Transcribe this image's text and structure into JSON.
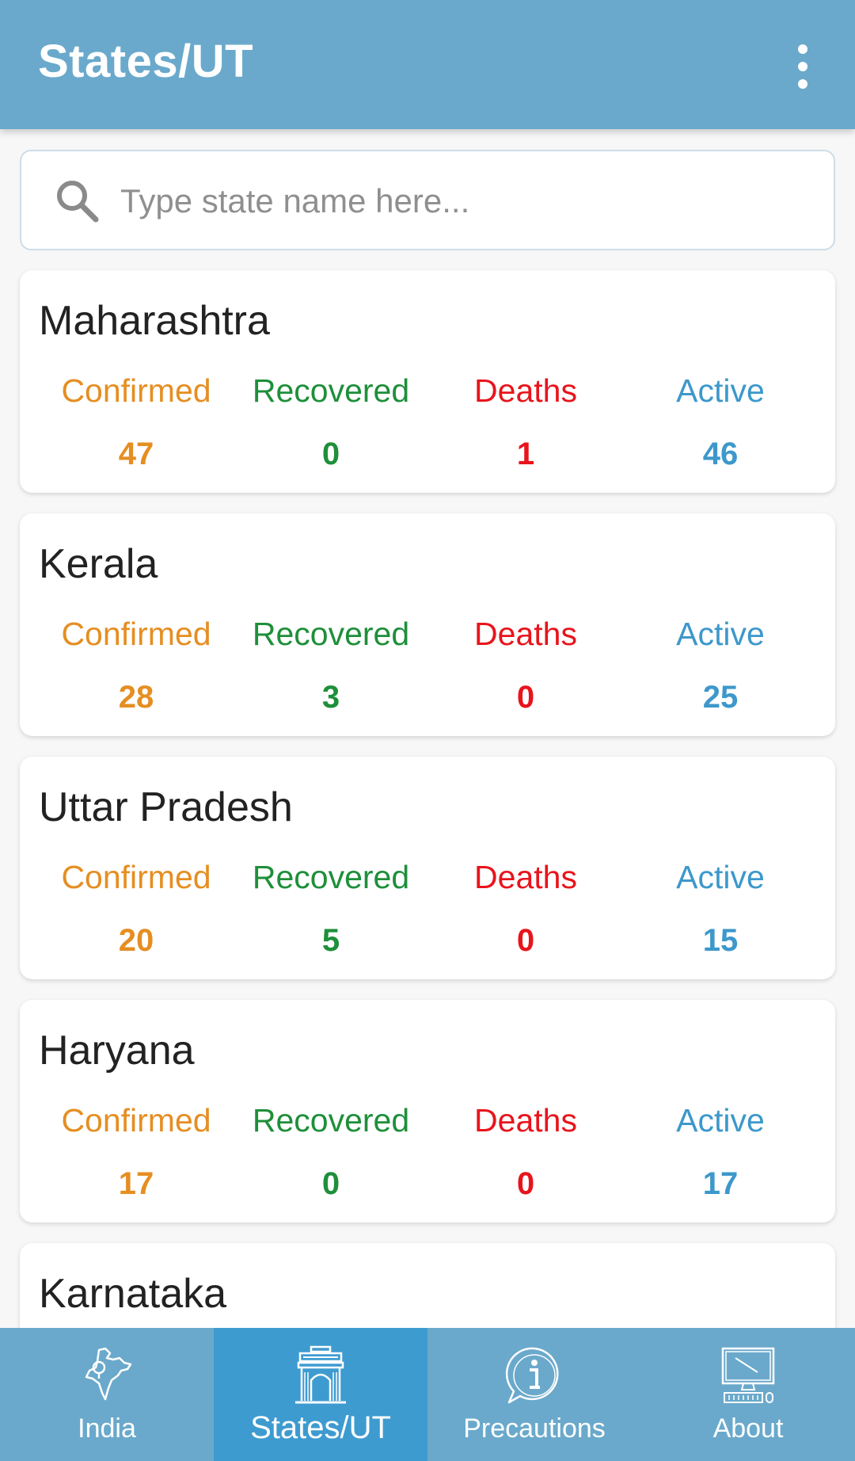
{
  "appbar": {
    "title": "States/UT",
    "menu_icon": "more-vert-icon"
  },
  "search": {
    "placeholder": "Type state name here...",
    "value": "",
    "icon": "search-icon"
  },
  "labels": {
    "confirmed": "Confirmed",
    "recovered": "Recovered",
    "deaths": "Deaths",
    "active": "Active"
  },
  "colors": {
    "confirmed": "#e58e22",
    "recovered": "#1e8f3a",
    "deaths": "#e8141c",
    "active": "#3d98cb",
    "appbar": "#6aa9cb",
    "nav_selected": "#3e9bd0"
  },
  "states": [
    {
      "name": "Maharashtra",
      "confirmed": "47",
      "recovered": "0",
      "deaths": "1",
      "active": "46"
    },
    {
      "name": "Kerala",
      "confirmed": "28",
      "recovered": "3",
      "deaths": "0",
      "active": "25"
    },
    {
      "name": "Uttar Pradesh",
      "confirmed": "20",
      "recovered": "5",
      "deaths": "0",
      "active": "15"
    },
    {
      "name": "Haryana",
      "confirmed": "17",
      "recovered": "0",
      "deaths": "0",
      "active": "17"
    },
    {
      "name": "Karnataka"
    }
  ],
  "nav": [
    {
      "label": "India",
      "icon": "india-map-icon",
      "selected": false
    },
    {
      "label": "States/UT",
      "icon": "india-gate-icon",
      "selected": true
    },
    {
      "label": "Precautions",
      "icon": "info-bubble-icon",
      "selected": false
    },
    {
      "label": "About",
      "icon": "computer-icon",
      "selected": false
    }
  ]
}
